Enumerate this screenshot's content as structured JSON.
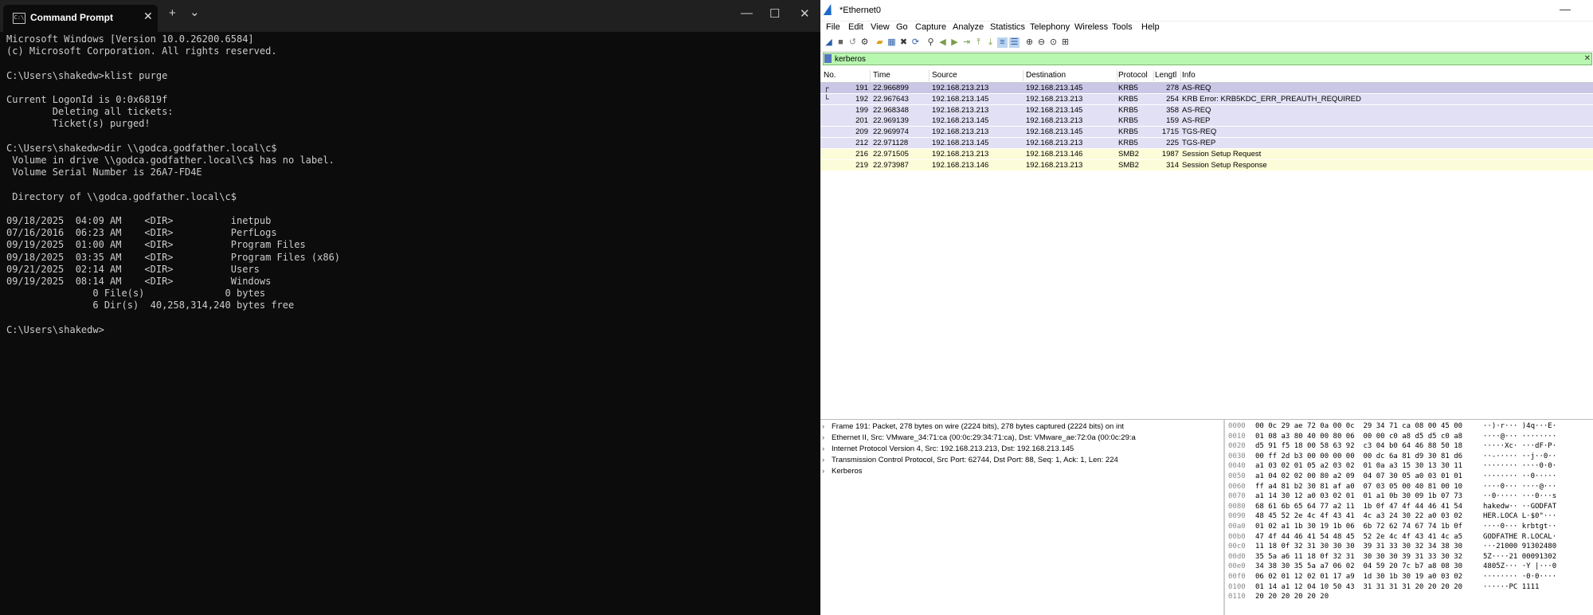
{
  "cmd": {
    "tab_title": "Command Prompt",
    "tab_icon": "cmd-icon",
    "close_glyph": "✕",
    "new_tab_glyph": "+",
    "dropdown_glyph": "⌄",
    "min_glyph": "—",
    "max_glyph": "☐",
    "win_close_glyph": "✕",
    "lines": [
      "Microsoft Windows [Version 10.0.26200.6584]",
      "(c) Microsoft Corporation. All rights reserved.",
      "",
      "C:\\Users\\shakedw>klist purge",
      "",
      "Current LogonId is 0:0x6819f",
      "        Deleting all tickets:",
      "        Ticket(s) purged!",
      "",
      "C:\\Users\\shakedw>dir \\\\godca.godfather.local\\c$",
      " Volume in drive \\\\godca.godfather.local\\c$ has no label.",
      " Volume Serial Number is 26A7-FD4E",
      "",
      " Directory of \\\\godca.godfather.local\\c$",
      "",
      "09/18/2025  04:09 AM    <DIR>          inetpub",
      "07/16/2016  06:23 AM    <DIR>          PerfLogs",
      "09/19/2025  01:00 AM    <DIR>          Program Files",
      "09/18/2025  03:35 AM    <DIR>          Program Files (x86)",
      "09/21/2025  02:14 AM    <DIR>          Users",
      "09/19/2025  08:14 AM    <DIR>          Windows",
      "               0 File(s)              0 bytes",
      "               6 Dir(s)  40,258,314,240 bytes free",
      "",
      "C:\\Users\\shakedw>"
    ]
  },
  "ws": {
    "title": "*Ethernet0",
    "min_glyph": "—",
    "menu": [
      "File",
      "Edit",
      "View",
      "Go",
      "Capture",
      "Analyze",
      "Statistics",
      "Telephony",
      "Wireless",
      "Tools",
      "Help"
    ],
    "filter": {
      "value": "kerberos",
      "clear_glyph": "✕"
    },
    "columns": [
      "No.",
      "Time",
      "Source",
      "Destination",
      "Protocol",
      "Lengtl",
      "Info"
    ],
    "packets": [
      {
        "no": "191",
        "time": "22.966899",
        "src": "192.168.213.213",
        "dst": "192.168.213.145",
        "proto": "KRB5",
        "len": "278",
        "info": "AS-REQ",
        "style": "row-kerb-sel",
        "marker": "┌"
      },
      {
        "no": "192",
        "time": "22.967643",
        "src": "192.168.213.145",
        "dst": "192.168.213.213",
        "proto": "KRB5",
        "len": "254",
        "info": "KRB Error: KRB5KDC_ERR_PREAUTH_REQUIRED",
        "style": "row-kerb",
        "marker": "└"
      },
      {
        "no": "199",
        "time": "22.968348",
        "src": "192.168.213.213",
        "dst": "192.168.213.145",
        "proto": "KRB5",
        "len": "358",
        "info": "AS-REQ",
        "style": "row-kerb",
        "marker": ""
      },
      {
        "no": "201",
        "time": "22.969139",
        "src": "192.168.213.145",
        "dst": "192.168.213.213",
        "proto": "KRB5",
        "len": "159",
        "info": "AS-REP",
        "style": "row-kerb",
        "marker": ""
      },
      {
        "no": "209",
        "time": "22.969974",
        "src": "192.168.213.213",
        "dst": "192.168.213.145",
        "proto": "KRB5",
        "len": "1715",
        "info": "TGS-REQ",
        "style": "row-kerb",
        "marker": ""
      },
      {
        "no": "212",
        "time": "22.971128",
        "src": "192.168.213.145",
        "dst": "192.168.213.213",
        "proto": "KRB5",
        "len": "225",
        "info": "TGS-REP",
        "style": "row-kerb",
        "marker": ""
      },
      {
        "no": "216",
        "time": "22.971505",
        "src": "192.168.213.213",
        "dst": "192.168.213.146",
        "proto": "SMB2",
        "len": "1987",
        "info": "Session Setup Request",
        "style": "row-smb",
        "marker": ""
      },
      {
        "no": "219",
        "time": "22.973987",
        "src": "192.168.213.146",
        "dst": "192.168.213.213",
        "proto": "SMB2",
        "len": "314",
        "info": "Session Setup Response",
        "style": "row-smb",
        "marker": ""
      }
    ],
    "details": [
      "Frame 191: Packet, 278 bytes on wire (2224 bits), 278 bytes captured (2224 bits) on int",
      "Ethernet II, Src: VMware_34:71:ca (00:0c:29:34:71:ca), Dst: VMware_ae:72:0a (00:0c:29:a",
      "Internet Protocol Version 4, Src: 192.168.213.213, Dst: 192.168.213.145",
      "Transmission Control Protocol, Src Port: 62744, Dst Port: 88, Seq: 1, Ack: 1, Len: 224",
      "Kerberos"
    ],
    "detail_arrow": "›",
    "hex": [
      {
        "off": "0000",
        "bytes": "00 0c 29 ae 72 0a 00 0c  29 34 71 ca 08 00 45 00",
        "ascii": "··)·r··· )4q···E·"
      },
      {
        "off": "0010",
        "bytes": "01 08 a3 80 40 00 80 06  00 00 c0 a8 d5 d5 c0 a8",
        "ascii": "····@··· ········"
      },
      {
        "off": "0020",
        "bytes": "d5 91 f5 18 00 58 63 92  c3 04 b0 64 46 88 50 18",
        "ascii": "·····Xc· ···dF·P·"
      },
      {
        "off": "0030",
        "bytes": "00 ff 2d b3 00 00 00 00  00 dc 6a 81 d9 30 81 d6",
        "ascii": "··-····· ··j··0··"
      },
      {
        "off": "0040",
        "bytes": "a1 03 02 01 05 a2 03 02  01 0a a3 15 30 13 30 11",
        "ascii": "········ ····0·0·"
      },
      {
        "off": "0050",
        "bytes": "a1 04 02 02 00 80 a2 09  04 07 30 05 a0 03 01 01",
        "ascii": "········ ··0·····"
      },
      {
        "off": "0060",
        "bytes": "ff a4 81 b2 30 81 af a0  07 03 05 00 40 81 00 10",
        "ascii": "····0··· ····@···"
      },
      {
        "off": "0070",
        "bytes": "a1 14 30 12 a0 03 02 01  01 a1 0b 30 09 1b 07 73",
        "ascii": "··0····· ···0···s"
      },
      {
        "off": "0080",
        "bytes": "68 61 6b 65 64 77 a2 11  1b 0f 47 4f 44 46 41 54",
        "ascii": "hakedw·· ··GODFAT"
      },
      {
        "off": "0090",
        "bytes": "48 45 52 2e 4c 4f 43 41  4c a3 24 30 22 a0 03 02",
        "ascii": "HER.LOCA L·$0\"···"
      },
      {
        "off": "00a0",
        "bytes": "01 02 a1 1b 30 19 1b 06  6b 72 62 74 67 74 1b 0f",
        "ascii": "····0··· krbtgt··"
      },
      {
        "off": "00b0",
        "bytes": "47 4f 44 46 41 54 48 45  52 2e 4c 4f 43 41 4c a5",
        "ascii": "GODFATHE R.LOCAL·"
      },
      {
        "off": "00c0",
        "bytes": "11 18 0f 32 31 30 30 30  39 31 33 30 32 34 38 30",
        "ascii": "···21000 91302480"
      },
      {
        "off": "00d0",
        "bytes": "35 5a a6 11 18 0f 32 31  30 30 30 39 31 33 30 32",
        "ascii": "5Z····21 00091302"
      },
      {
        "off": "00e0",
        "bytes": "34 38 30 35 5a a7 06 02  04 59 20 7c b7 a8 08 30",
        "ascii": "4805Z··· ·Y |···0"
      },
      {
        "off": "00f0",
        "bytes": "06 02 01 12 02 01 17 a9  1d 30 1b 30 19 a0 03 02",
        "ascii": "········ ·0·0····"
      },
      {
        "off": "0100",
        "bytes": "01 14 a1 12 04 10 50 43  31 31 31 31 20 20 20 20",
        "ascii": "······PC 1111    "
      },
      {
        "off": "0110",
        "bytes": "20 20 20 20 20 20",
        "ascii": "      "
      }
    ]
  }
}
